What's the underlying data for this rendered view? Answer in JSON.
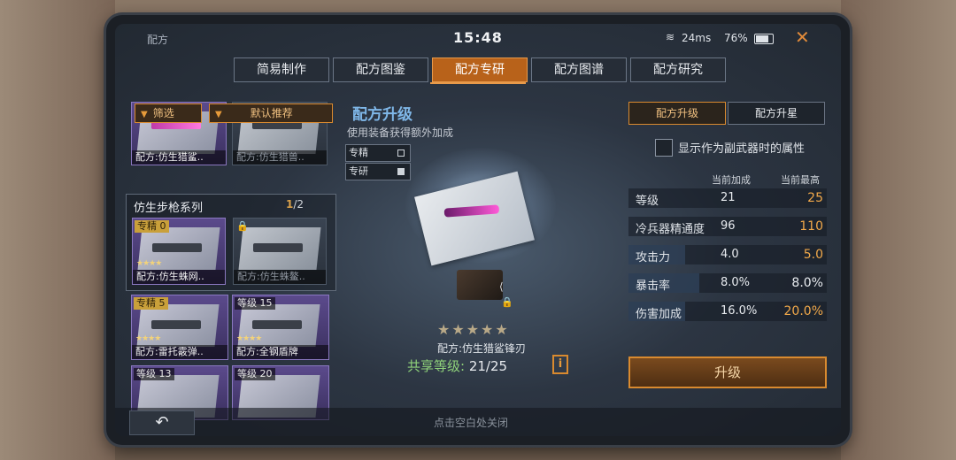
{
  "status": {
    "title": "配方",
    "time": "15:48",
    "ping": "24ms",
    "battery": "76%"
  },
  "tabs": [
    "简易制作",
    "配方图鉴",
    "配方专研",
    "配方图谱",
    "配方研究"
  ],
  "active_tab": "配方专研",
  "left": {
    "filter": "筛选",
    "sort": "默认推荐",
    "top_cards": [
      {
        "name": "配方:仿生猎鲨.."
      },
      {
        "name": "配方:仿生猎兽.."
      }
    ],
    "series": {
      "title": "仿生步枪系列",
      "current": "1",
      "total": "/2"
    },
    "series_cards": [
      {
        "badge": "专精 0",
        "name": "配方:仿生蛛网.."
      },
      {
        "name": "配方:仿生蛛鳌.."
      }
    ],
    "cards": [
      {
        "badge": "专精 5",
        "name": "配方:雷托霰弹.."
      },
      {
        "badge": "等级 15",
        "name": "配方:全钢盾牌"
      },
      {
        "badge": "等级 13"
      },
      {
        "badge": "等级 20"
      }
    ]
  },
  "center": {
    "title": "配方升级",
    "subtitle": "使用装备获得额外加成",
    "legend": [
      "专精",
      "专研"
    ],
    "item_name": "配方:仿生猎鲨锋刃",
    "share_label": "共享等级:",
    "share_value": "21/25",
    "info": "i",
    "stars": "★★★★★"
  },
  "right": {
    "tabs": [
      "配方升级",
      "配方升星"
    ],
    "checkbox_label": "显示作为副武器时的属性",
    "col_current": "当前加成",
    "col_max": "当前最高",
    "stats": [
      {
        "name": "等级",
        "current": "21",
        "max": "25",
        "fill": 0.0
      },
      {
        "name": "冷兵器精通度",
        "current": "96",
        "max": "110",
        "fill": 0.0
      },
      {
        "name": "攻击力",
        "current": "4.0",
        "max": "5.0",
        "fill": 0.8
      },
      {
        "name": "暴击率",
        "current": "8.0%",
        "max": "8.0%",
        "fill": 1.0
      },
      {
        "name": "伤害加成",
        "current": "16.0%",
        "max": "20.0%",
        "fill": 0.8
      }
    ],
    "upgrade": "升级"
  },
  "bottom": {
    "back": "↶",
    "hint": "点击空白处关闭"
  },
  "colors": {
    "accent": "#d98a2f",
    "active_tab": "#b8621a",
    "highlight": "#f2a94a"
  }
}
